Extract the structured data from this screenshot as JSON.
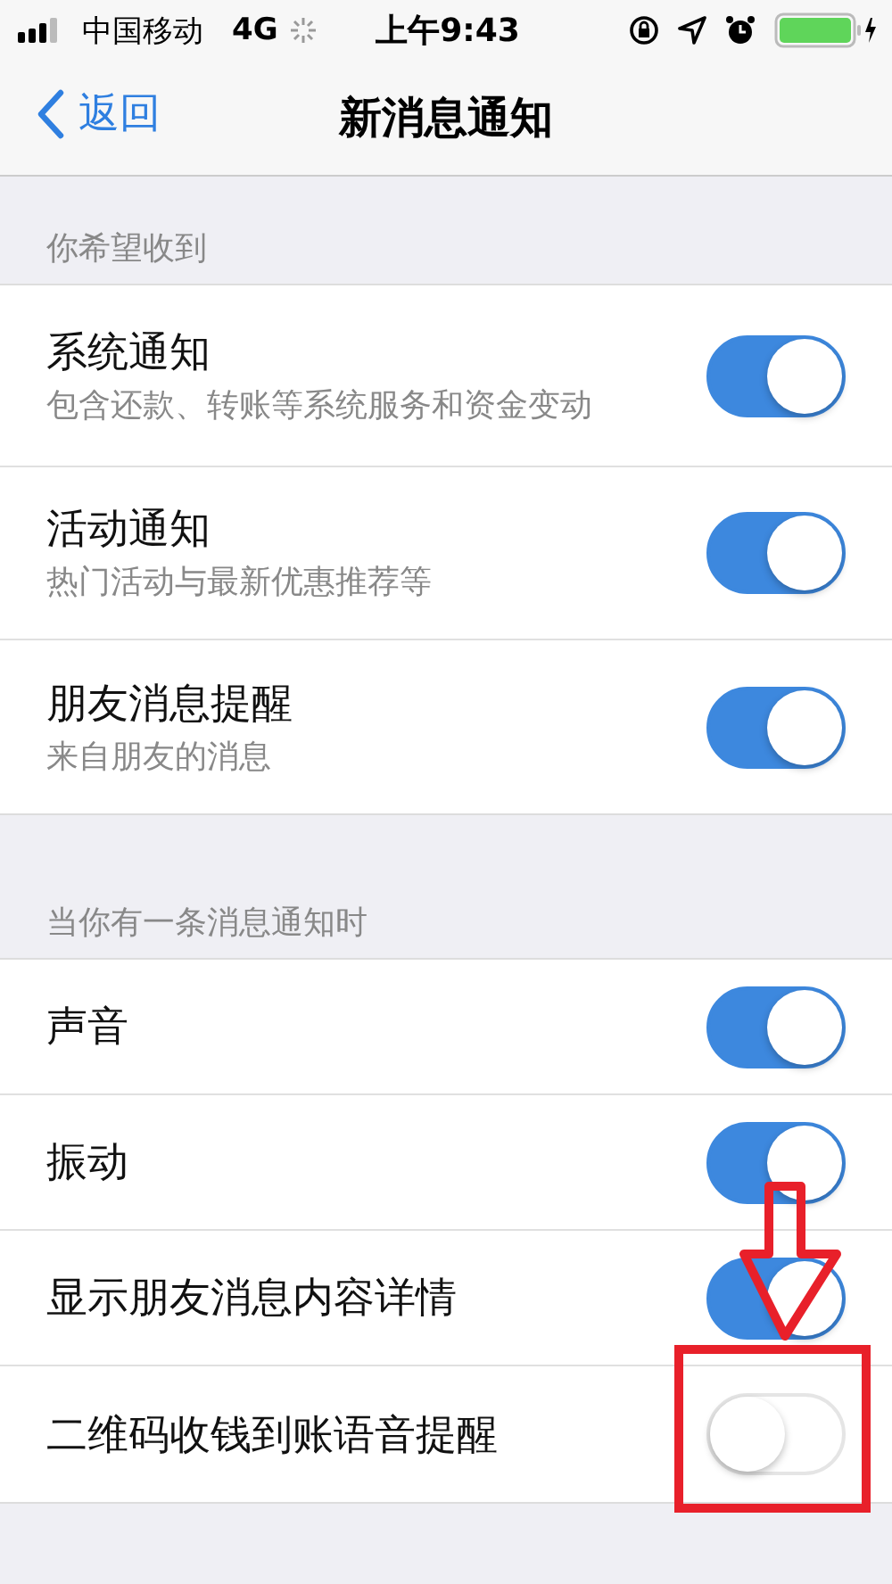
{
  "status_bar": {
    "carrier": "中国移动",
    "network": "4G",
    "time": "上午9:43"
  },
  "nav": {
    "back": "返回",
    "title": "新消息通知"
  },
  "sections": [
    {
      "header": "你希望收到",
      "items": [
        {
          "title": "系统通知",
          "subtitle": "包含还款、转账等系统服务和资金变动",
          "on": true
        },
        {
          "title": "活动通知",
          "subtitle": "热门活动与最新优惠推荐等",
          "on": true
        },
        {
          "title": "朋友消息提醒",
          "subtitle": "来自朋友的消息",
          "on": true
        }
      ]
    },
    {
      "header": "当你有一条消息通知时",
      "items": [
        {
          "title": "声音",
          "on": true
        },
        {
          "title": "振动",
          "on": true
        },
        {
          "title": "显示朋友消息内容详情",
          "on": true
        },
        {
          "title": "二维码收钱到账语音提醒",
          "on": false
        }
      ]
    }
  ]
}
